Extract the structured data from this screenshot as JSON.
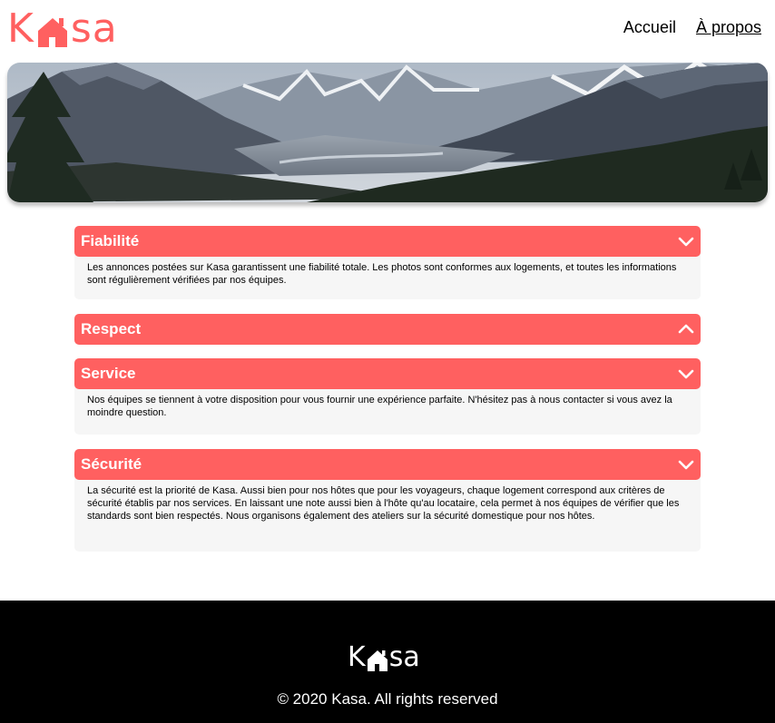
{
  "brand": {
    "logo_letters": [
      "K",
      "sa"
    ],
    "accent_color": "#FF6060"
  },
  "nav": {
    "items": [
      {
        "label": "Accueil",
        "active": false
      },
      {
        "label": "À propos",
        "active": true
      }
    ]
  },
  "banner": {
    "icon": "mountain-landscape-image"
  },
  "collapses": [
    {
      "title": "Fiabilité",
      "open": true,
      "chevron": "chevron-down-icon",
      "text": "Les annonces postées sur Kasa garantissent une fiabilité totale. Les photos sont conformes aux logements, et toutes les informations sont régulièrement vérifiées par nos équipes."
    },
    {
      "title": "Respect",
      "open": false,
      "chevron": "chevron-up-icon",
      "text": ""
    },
    {
      "title": "Service",
      "open": true,
      "chevron": "chevron-down-icon",
      "text": "Nos équipes se tiennent à votre disposition pour vous fournir une expérience parfaite. N'hésitez pas à nous contacter si vous avez la moindre question."
    },
    {
      "title": "Sécurité",
      "open": true,
      "chevron": "chevron-down-icon",
      "text": "La sécurité est la priorité de Kasa. Aussi bien pour nos hôtes que pour les voyageurs, chaque logement correspond aux critères de sécurité établis par nos services. En laissant une note aussi bien à l'hôte qu'au locataire, cela permet à nos équipes de vérifier que les standards sont bien respectés. Nous organisons également des ateliers sur la sécurité domestique pour nos hôtes."
    }
  ],
  "footer": {
    "copyright": "© 2020 Kasa. All rights reserved"
  }
}
